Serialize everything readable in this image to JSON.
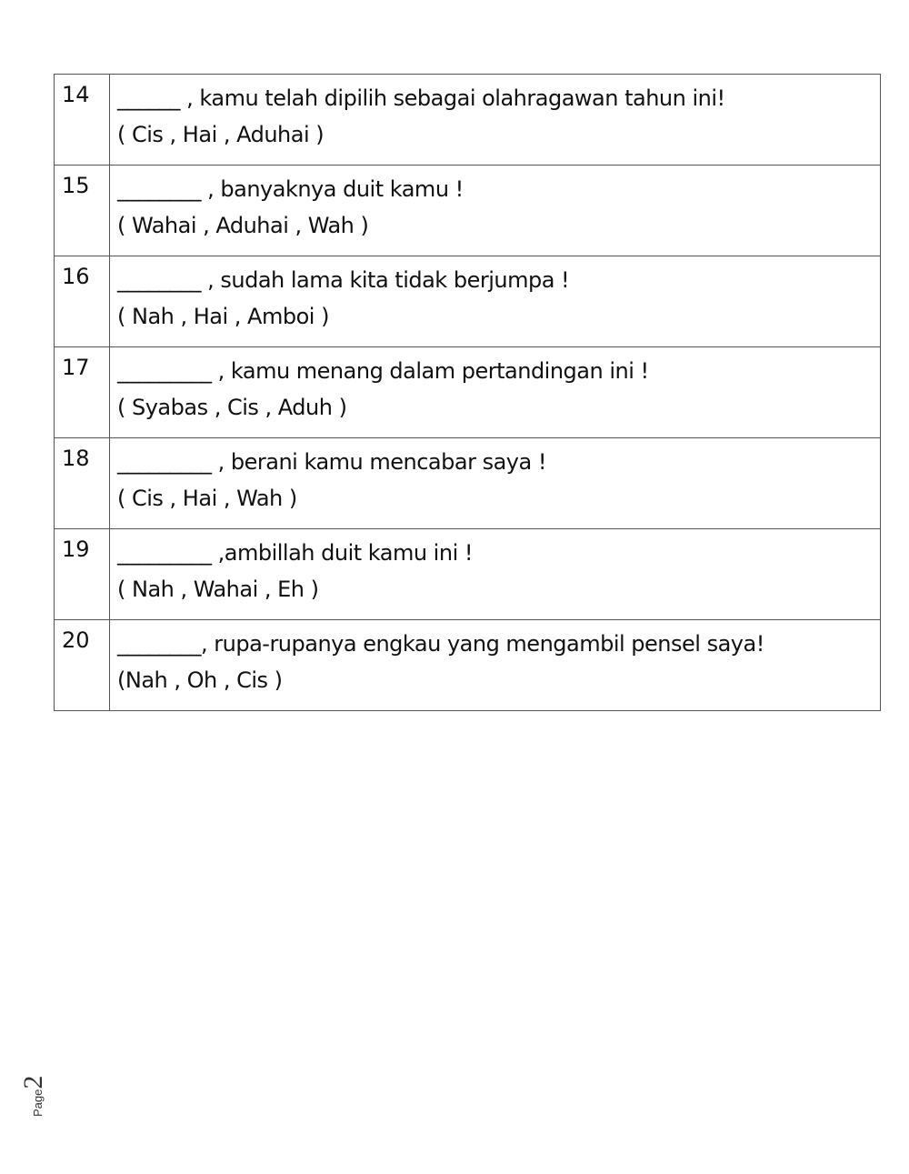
{
  "worksheet": {
    "questions": [
      {
        "number": "14",
        "sentence": "______ , kamu telah dipilih sebagai olahragawan tahun ini!",
        "options": "( Cis , Hai , Aduhai )"
      },
      {
        "number": "15",
        "sentence": "________ , banyaknya duit kamu !",
        "options": "( Wahai , Aduhai , Wah )"
      },
      {
        "number": "16",
        "sentence": "________ , sudah lama kita tidak berjumpa !",
        "options": "( Nah , Hai , Amboi )"
      },
      {
        "number": "17",
        "sentence": "_________ , kamu menang dalam pertandingan ini !",
        "options": "( Syabas , Cis , Aduh )"
      },
      {
        "number": "18",
        "sentence": "_________ , berani kamu mencabar saya !",
        "options": "( Cis , Hai , Wah )"
      },
      {
        "number": "19",
        "sentence": "_________ ,ambillah duit kamu ini !",
        "options": "( Nah , Wahai , Eh )"
      },
      {
        "number": "20",
        "sentence": "________, rupa-rupanya engkau yang mengambil pensel saya!",
        "options": "(Nah , Oh , Cis )"
      }
    ]
  },
  "footer": {
    "page_word": "Page",
    "page_number": "2"
  }
}
